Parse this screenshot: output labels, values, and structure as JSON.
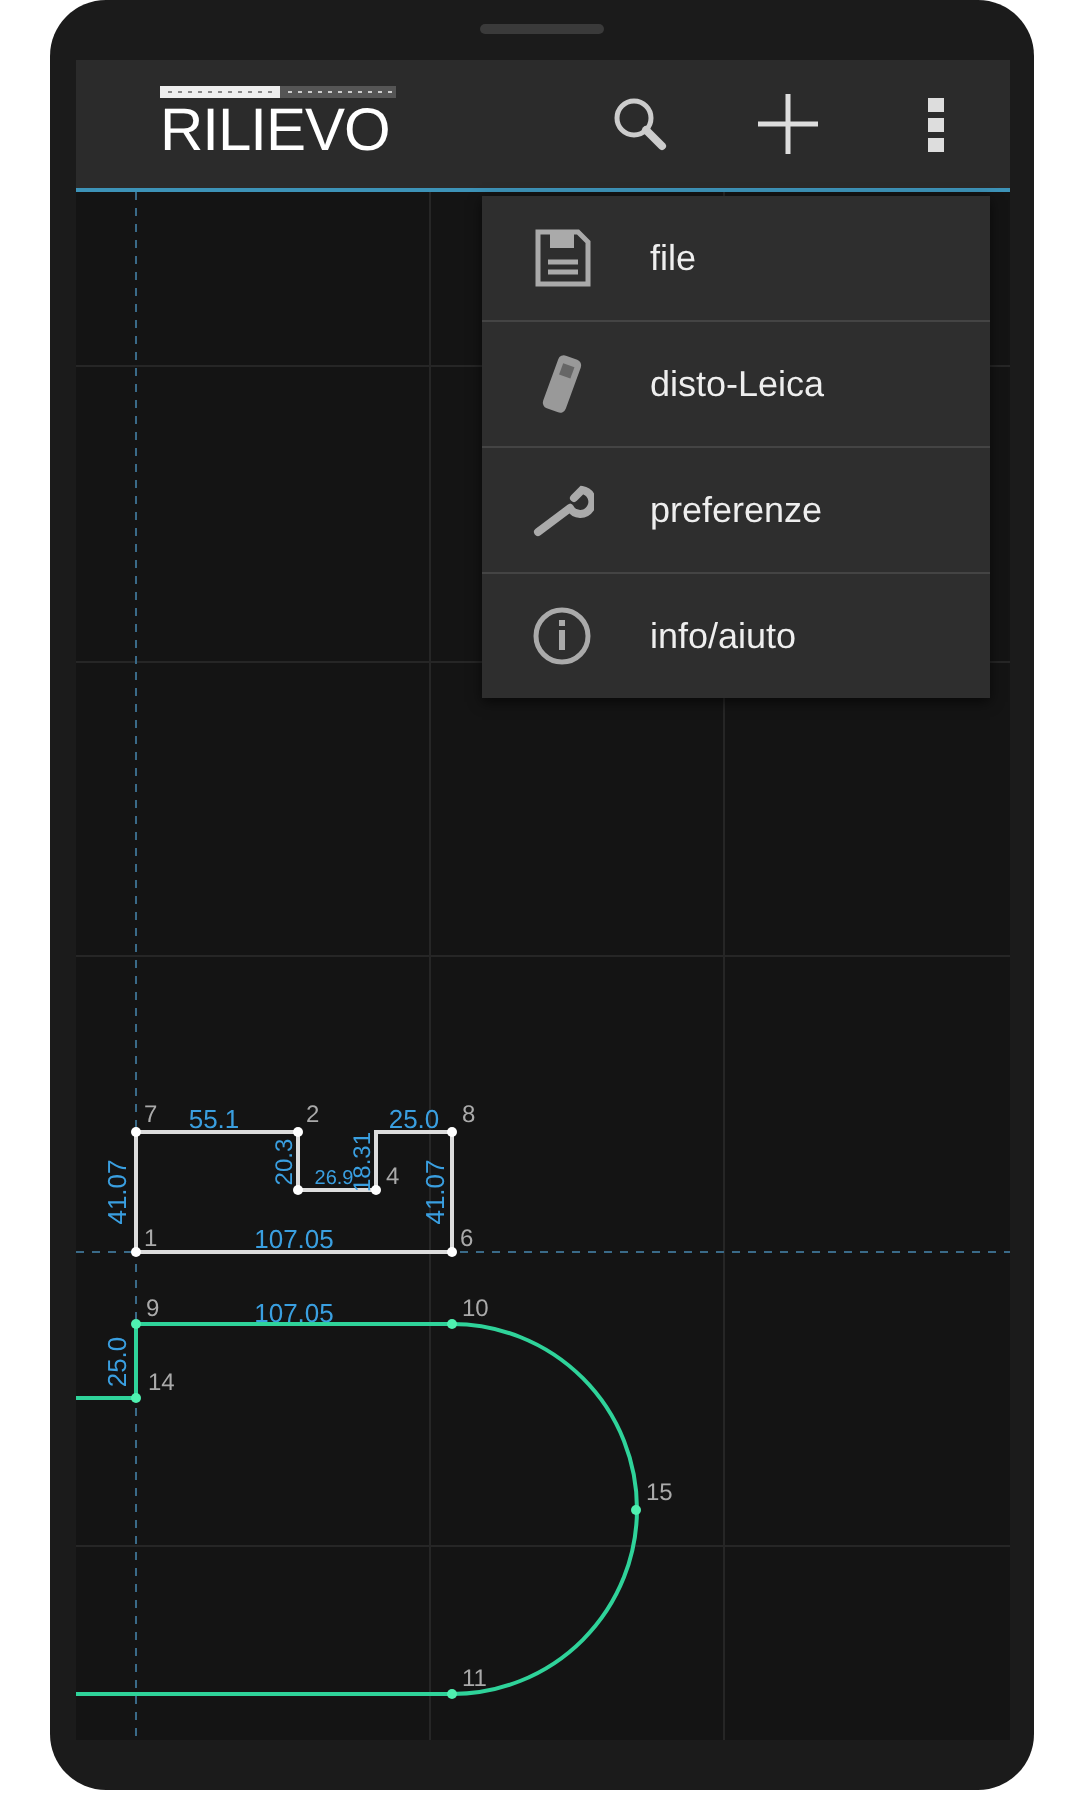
{
  "app_bar": {
    "title": "RILIEVO"
  },
  "menu": [
    {
      "label": "file"
    },
    {
      "label": "disto-Leica"
    },
    {
      "label": "preferenze"
    },
    {
      "label": "info/aiuto"
    }
  ],
  "drawing": {
    "point_labels": [
      "7",
      "2",
      "8",
      "4",
      "1",
      "6",
      "9",
      "10",
      "14",
      "15",
      "11"
    ],
    "dimension_labels": [
      "55.1",
      "41.07",
      "107.05",
      "20.3",
      "18.31",
      "26.9",
      "25.0",
      "41.07",
      "107.05",
      "25.0"
    ]
  }
}
